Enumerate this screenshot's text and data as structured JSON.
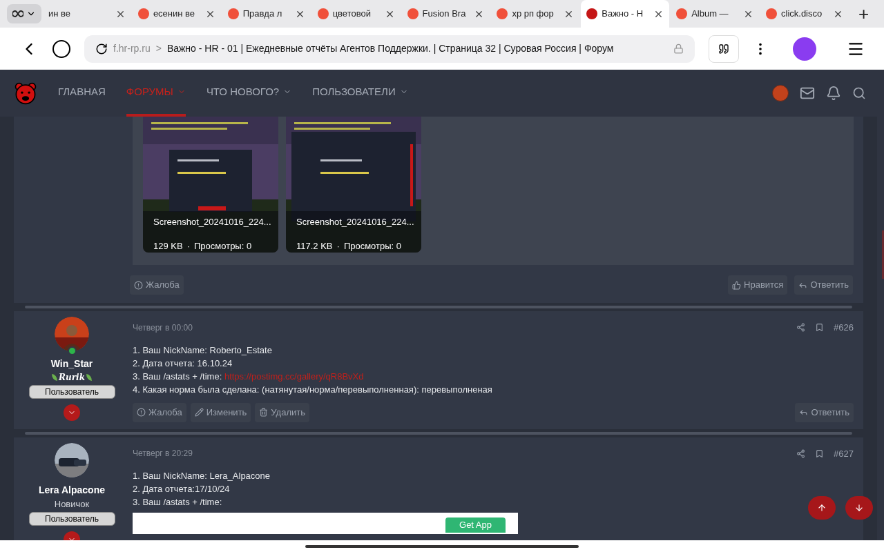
{
  "browser": {
    "tabs": [
      {
        "label": "ин ве",
        "selected": false
      },
      {
        "label": "есенин ве",
        "selected": false
      },
      {
        "label": "Правда л",
        "selected": false
      },
      {
        "label": "цветовой",
        "selected": false
      },
      {
        "label": "Fusion Bra",
        "selected": false
      },
      {
        "label": "хр рп фор",
        "selected": false
      },
      {
        "label": "Важно - Н",
        "selected": true
      },
      {
        "label": "Album — ",
        "selected": false
      },
      {
        "label": "click.disco",
        "selected": false
      }
    ],
    "new_tab": "+",
    "domain": "f.hr-rp.ru",
    "separator": ">",
    "page_title": "Важно - HR - 01 | Ежедневные отчёты Агентов Поддержки. | Страница 32 | Суровая Россия | Форум"
  },
  "nav": {
    "items": [
      {
        "label": "ГЛАВНАЯ",
        "selected": false,
        "dropdown": false
      },
      {
        "label": "ФОРУМЫ",
        "selected": true,
        "dropdown": true
      },
      {
        "label": "ЧТО НОВОГО?",
        "selected": false,
        "dropdown": true
      },
      {
        "label": "ПОЛЬЗОВАТЕЛИ",
        "selected": false,
        "dropdown": true
      }
    ]
  },
  "first_post": {
    "attachments": [
      {
        "name": "Screenshot_20241016_224...",
        "size": "129 KB",
        "views": "Просмотры: 0"
      },
      {
        "name": "Screenshot_20241016_224...",
        "size": "117.2 KB",
        "views": "Просмотры: 0"
      }
    ],
    "dot": "·",
    "actions_left": [
      "Жалоба"
    ],
    "actions_right": [
      {
        "kind": "like",
        "label": "Нравится"
      },
      {
        "kind": "reply",
        "label": "Ответить"
      }
    ]
  },
  "posts": [
    {
      "author": "Win_Star",
      "user_title": "Rurik",
      "online": true,
      "badge": "Пользователь",
      "date": "Четверг в 00:00",
      "number": "#626",
      "lines": [
        {
          "text": "1. Ваш NickName: Roberto_Estate"
        },
        {
          "text": "2. Дата отчета: 16.10.24"
        },
        {
          "text": "3. Ваш /astats + /time: ",
          "link": "https://postimg.cc/gallery/qR8BvXd"
        },
        {
          "text": "4. Какая норма была сделана: (натянутая/норма/перевыполненная): перевыполненая"
        }
      ],
      "actions_left": [
        {
          "kind": "report",
          "label": "Жалоба"
        },
        {
          "kind": "edit",
          "label": "Изменить"
        },
        {
          "kind": "delete",
          "label": "Удалить"
        }
      ],
      "actions_right": [
        {
          "kind": "reply",
          "label": "Ответить"
        }
      ]
    },
    {
      "author": "Lera Alpacone",
      "user_title": "Новичок",
      "online": false,
      "badge": "Пользователь",
      "date": "Четверг в 20:29",
      "number": "#627",
      "lines": [
        {
          "text": "1. Ваш NickName: Lera_Alpacone"
        },
        {
          "text": "2. Дата отчета:17/10/24"
        },
        {
          "text": "3. Ваш /astats + /time:"
        }
      ],
      "ad_button": "Get App"
    }
  ]
}
